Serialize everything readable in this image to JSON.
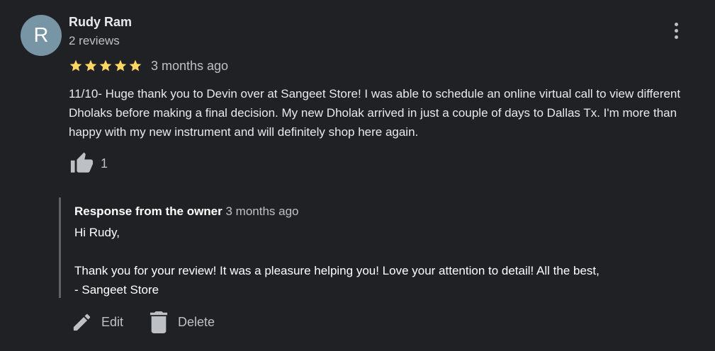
{
  "review": {
    "author": {
      "initial": "R",
      "name": "Rudy Ram",
      "meta": "2 reviews",
      "avatar_color": "#7895a6"
    },
    "rating": 5,
    "star_color": "#fdd663",
    "time": "3 months ago",
    "text": "11/10- Huge thank you to Devin over at Sangeet Store! I was able to schedule an online virtual call to view different Dholaks before making a final decision. My new Dholak arrived in just a couple of days to Dallas Tx. I'm more than happy with my new instrument and will definitely shop here again.",
    "likes": {
      "icon": "thumbs-up-icon",
      "count": "1"
    },
    "more_icon": "more-vertical-icon"
  },
  "owner_response": {
    "label": "Response from the owner",
    "time": "3 months ago",
    "text": "Hi Rudy,\n\nThank you for your review! It was a pleasure helping you! Love your attention to detail! All the best,\n- Sangeet Store"
  },
  "actions": {
    "edit_label": "Edit",
    "edit_icon": "pencil-icon",
    "delete_label": "Delete",
    "delete_icon": "trash-icon"
  },
  "colors": {
    "background": "#202124",
    "primary_text": "#e8eaed",
    "secondary_text": "#bdc1c6",
    "response_border": "#5f6368"
  }
}
